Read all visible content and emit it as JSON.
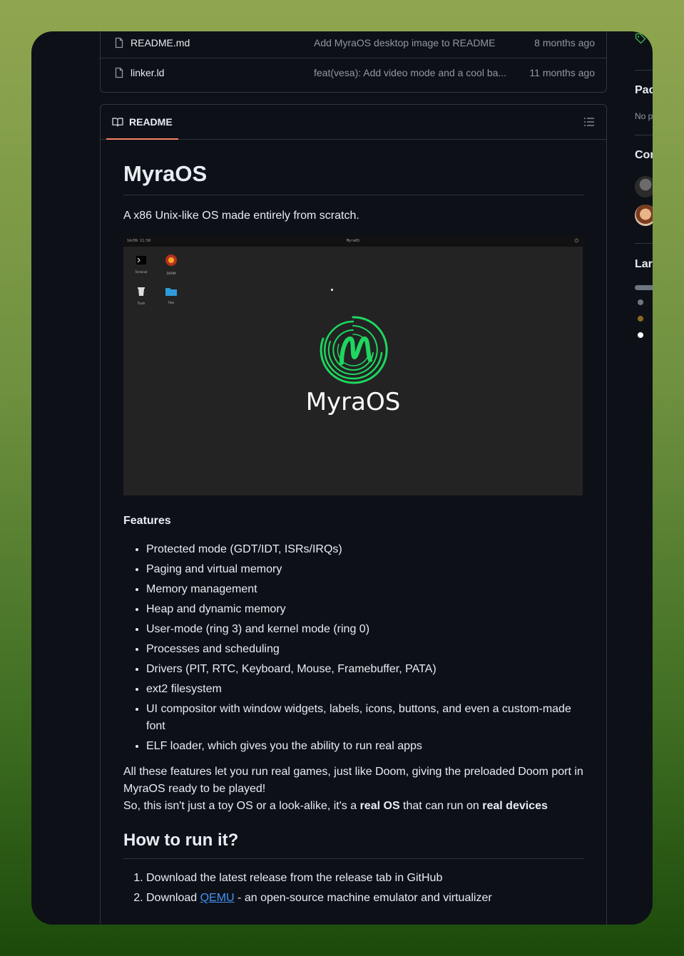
{
  "files": [
    {
      "name": "README.md",
      "message": "Add MyraOS desktop image to README",
      "time": "8 months ago"
    },
    {
      "name": "linker.ld",
      "message": "feat(vesa): Add video mode and a cool ba...",
      "time": "11 months ago"
    }
  ],
  "readme": {
    "tab_label": "README",
    "title": "MyraOS",
    "tagline": "A x86 Unix-like OS made entirely from scratch.",
    "screenshot": {
      "clock": "14/09 11:50",
      "window_title": "MyraOS",
      "icons": [
        "Terminal",
        "DOOM",
        "Trash",
        "Files"
      ],
      "logo_text": "MyraOS"
    },
    "features_heading": "Features",
    "features": [
      "Protected mode (GDT/IDT, ISRs/IRQs)",
      "Paging and virtual memory",
      "Memory management",
      "Heap and dynamic memory",
      "User-mode (ring 3) and kernel mode (ring 0)",
      "Processes and scheduling",
      "Drivers (PIT, RTC, Keyboard, Mouse, Framebuffer, PATA)",
      "ext2 filesystem",
      "UI compositor with window widgets, labels, icons, buttons, and even a custom-made font",
      "ELF loader, which gives you the ability to run real apps"
    ],
    "para1": "All these features let you run real games, just like Doom, giving the preloaded Doom port in MyraOS ready to be played!",
    "para2_pre": "So, this isn't just a toy OS or a look-alike, it's a ",
    "para2_bold1": "real OS",
    "para2_mid": " that can run on ",
    "para2_bold2": "real devices",
    "how_heading": "How to run it?",
    "step1": "Download the latest release from the release tab in GitHub",
    "step2_pre": "Download ",
    "step2_link": "QEMU",
    "step2_post": " - an open-source machine emulator and virtualizer"
  },
  "sidebar": {
    "packages_heading": "Pac",
    "packages_text": "No p",
    "contributors_heading": "Cor",
    "languages_heading": "Lar"
  },
  "colors": {
    "accent_tab": "#f78166",
    "link": "#4493f8",
    "logo_green": "#1ed760",
    "lang1": "#6e7681",
    "lang2": "#8a6a1c",
    "lang3": "#ffffff"
  }
}
